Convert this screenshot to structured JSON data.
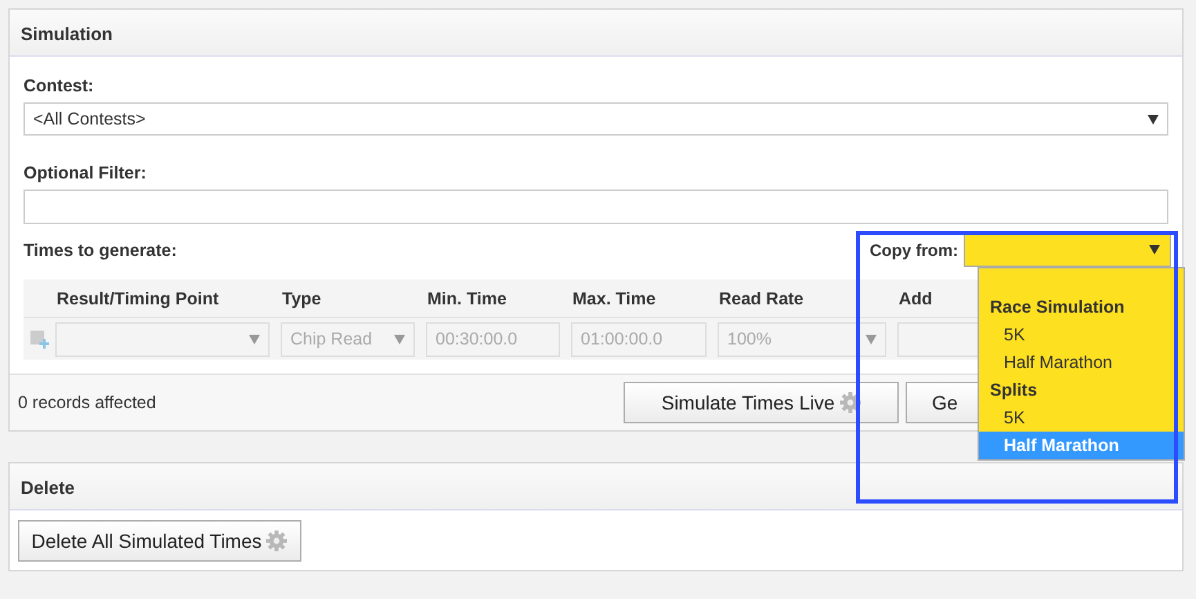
{
  "simulation": {
    "title": "Simulation",
    "contest": {
      "label": "Contest:",
      "value": "<All Contests>"
    },
    "filter": {
      "label": "Optional Filter:"
    },
    "times_label": "Times to generate:",
    "copy_from": {
      "label": "Copy from:",
      "expanded": true,
      "options": [
        {
          "kind": "group",
          "label": "Race Simulation"
        },
        {
          "kind": "option",
          "label": "5K",
          "selected": false
        },
        {
          "kind": "option",
          "label": "Half Marathon",
          "selected": false
        },
        {
          "kind": "group",
          "label": "Splits"
        },
        {
          "kind": "option",
          "label": "5K",
          "selected": false
        },
        {
          "kind": "option",
          "label": "Half Marathon",
          "selected": true
        }
      ]
    },
    "columns": [
      "Result/Timing Point",
      "Type",
      "Min. Time",
      "Max. Time",
      "Read Rate",
      "Add"
    ],
    "row": {
      "disabled": true,
      "cells": [
        {
          "kind": "select"
        },
        {
          "kind": "select",
          "value": "Chip Read"
        },
        {
          "kind": "input",
          "value": "00:30:00.0"
        },
        {
          "kind": "input",
          "value": "01:00:00.0"
        },
        {
          "kind": "select",
          "value": "100%"
        },
        {
          "kind": "input"
        }
      ]
    },
    "status": "0 records affected",
    "buttons": [
      {
        "label": "Simulate Times Live",
        "gear": true
      },
      {
        "label": "Ge",
        "gear": false
      }
    ]
  },
  "delete": {
    "title": "Delete",
    "button": "Delete All Simulated Times"
  }
}
